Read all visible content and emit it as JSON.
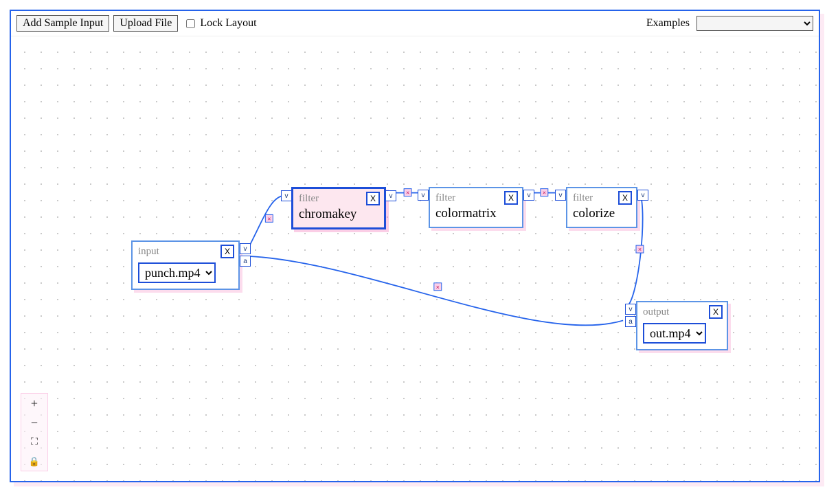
{
  "toolbar": {
    "add_sample_label": "Add Sample Input",
    "upload_label": "Upload File",
    "lock_label": "Lock Layout",
    "lock_checked": false,
    "examples_label": "Examples",
    "examples_selected": ""
  },
  "nodes": {
    "input": {
      "type_label": "input",
      "close": "X",
      "select_value": "punch.mp4"
    },
    "chromakey": {
      "type_label": "filter",
      "close": "X",
      "title": "chromakey",
      "selected": true
    },
    "colormatrix": {
      "type_label": "filter",
      "close": "X",
      "title": "colormatrix"
    },
    "colorize": {
      "type_label": "filter",
      "close": "X",
      "title": "colorize"
    },
    "output": {
      "type_label": "output",
      "close": "X",
      "select_value": "out.mp4"
    }
  },
  "port_labels": {
    "v": "v",
    "a": "a"
  },
  "controls": {
    "zoom_in": "+",
    "zoom_out": "−",
    "fit": "⛶",
    "lock": "🔒"
  }
}
